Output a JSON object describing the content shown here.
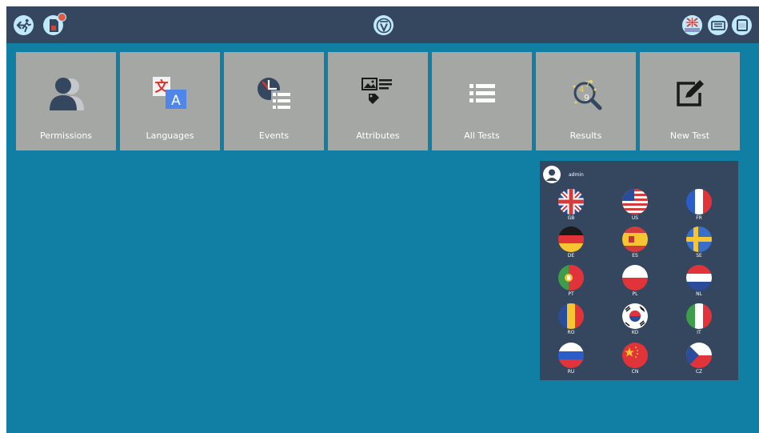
{
  "topbar": {
    "left_icons": [
      "exit-icon",
      "sim-card-icon"
    ],
    "center_icon": "v-logo-icon",
    "right_icons": [
      "uk-flag-icon",
      "keyboard-icon",
      "screen-icon"
    ]
  },
  "tiles": [
    {
      "label": "Permissions",
      "icon": "user-permissions-icon"
    },
    {
      "label": "Languages",
      "icon": "translate-icon"
    },
    {
      "label": "Events",
      "icon": "clock-list-icon"
    },
    {
      "label": "Attributes",
      "icon": "image-tag-icon"
    },
    {
      "label": "All Tests",
      "icon": "list-icon"
    },
    {
      "label": "Results",
      "icon": "magnifier-numbers-icon"
    },
    {
      "label": "New Test",
      "icon": "edit-icon"
    }
  ],
  "language_panel": {
    "username": "admin",
    "flags": [
      "GB",
      "US",
      "FR",
      "DE",
      "ES",
      "SE",
      "PT",
      "PL",
      "NL",
      "RO",
      "KO",
      "IT",
      "RU",
      "CN",
      "CZ"
    ]
  },
  "colors": {
    "background": "#117ea3",
    "topbar": "#34475f",
    "tile": "#a4a7a3",
    "panel": "#34475f"
  }
}
